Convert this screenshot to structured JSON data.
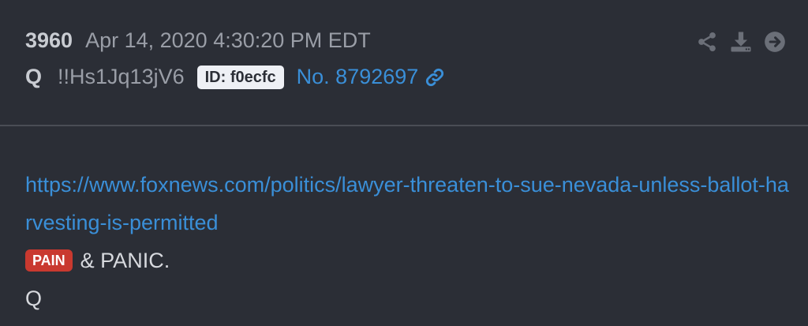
{
  "post": {
    "number": "3960",
    "timestamp": "Apr 14, 2020 4:30:20 PM EDT",
    "author": "Q",
    "tripcode": "!!Hs1Jq13jV6",
    "id_label": "ID: f0ecfc",
    "post_ref": "No. 8792697"
  },
  "actions": {
    "icons": [
      "share-icon",
      "download-icon",
      "arrow-right-icon"
    ]
  },
  "content": {
    "url": "https://www.foxnews.com/politics/lawyer-threaten-to-sue-nevada-unless-ballot-harvesting-is-permitted",
    "tag": "PAIN",
    "text": "& PANIC.",
    "signature": "Q"
  },
  "colors": {
    "background": "#2b2e36",
    "link": "#3a8fd8",
    "tag": "#c9392f",
    "badge": "#eef0f5"
  }
}
